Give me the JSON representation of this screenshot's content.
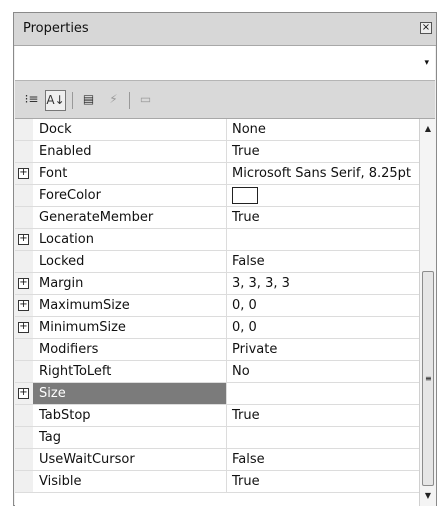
{
  "panel": {
    "title": "Properties",
    "close_glyph": "×",
    "combo_value": "",
    "combo_arrow_glyph": "▾"
  },
  "toolbar": {
    "buttons": [
      {
        "icon": "categorized-icon",
        "glyph": "⁝≡",
        "active": false,
        "enabled": true
      },
      {
        "icon": "alphabetical-sort-icon",
        "glyph": "A↓",
        "active": true,
        "enabled": true
      },
      {
        "icon": "properties-icon",
        "glyph": "▤",
        "active": false,
        "enabled": true
      },
      {
        "icon": "events-icon",
        "glyph": "⚡",
        "active": false,
        "enabled": false
      },
      {
        "icon": "property-pages-icon",
        "glyph": "▭",
        "active": false,
        "enabled": false
      }
    ]
  },
  "properties": [
    {
      "name": "Dock",
      "value": "None",
      "expandable": false
    },
    {
      "name": "Enabled",
      "value": "True",
      "expandable": false
    },
    {
      "name": "Font",
      "value": "Microsoft Sans Serif, 8.25pt",
      "expandable": true
    },
    {
      "name": "ForeColor",
      "value": "",
      "expandable": false,
      "color_swatch": "#ffffff"
    },
    {
      "name": "GenerateMember",
      "value": "True",
      "expandable": false
    },
    {
      "name": "Location",
      "value": "",
      "expandable": true
    },
    {
      "name": "Locked",
      "value": "False",
      "expandable": false
    },
    {
      "name": "Margin",
      "value": "3, 3, 3, 3",
      "expandable": true
    },
    {
      "name": "MaximumSize",
      "value": "0, 0",
      "expandable": true
    },
    {
      "name": "MinimumSize",
      "value": "0, 0",
      "expandable": true
    },
    {
      "name": "Modifiers",
      "value": "Private",
      "expandable": false
    },
    {
      "name": "RightToLeft",
      "value": "No",
      "expandable": false
    },
    {
      "name": "Size",
      "value": "",
      "expandable": true,
      "selected": true
    },
    {
      "name": "TabStop",
      "value": "True",
      "expandable": false
    },
    {
      "name": "Tag",
      "value": "",
      "expandable": false
    },
    {
      "name": "UseWaitCursor",
      "value": "False",
      "expandable": false
    },
    {
      "name": "Visible",
      "value": "True",
      "expandable": false
    }
  ],
  "expander_glyph": "+",
  "scrollbar": {
    "up_glyph": "▲",
    "down_glyph": "▼",
    "grip_glyph": "≡",
    "thumb_start_fraction": 0.38,
    "thumb_size_fraction": 0.62
  },
  "colors": {
    "selection": "#7b7b7b",
    "panel_background": "#f0f0f0",
    "grid_background": "#ffffff"
  }
}
